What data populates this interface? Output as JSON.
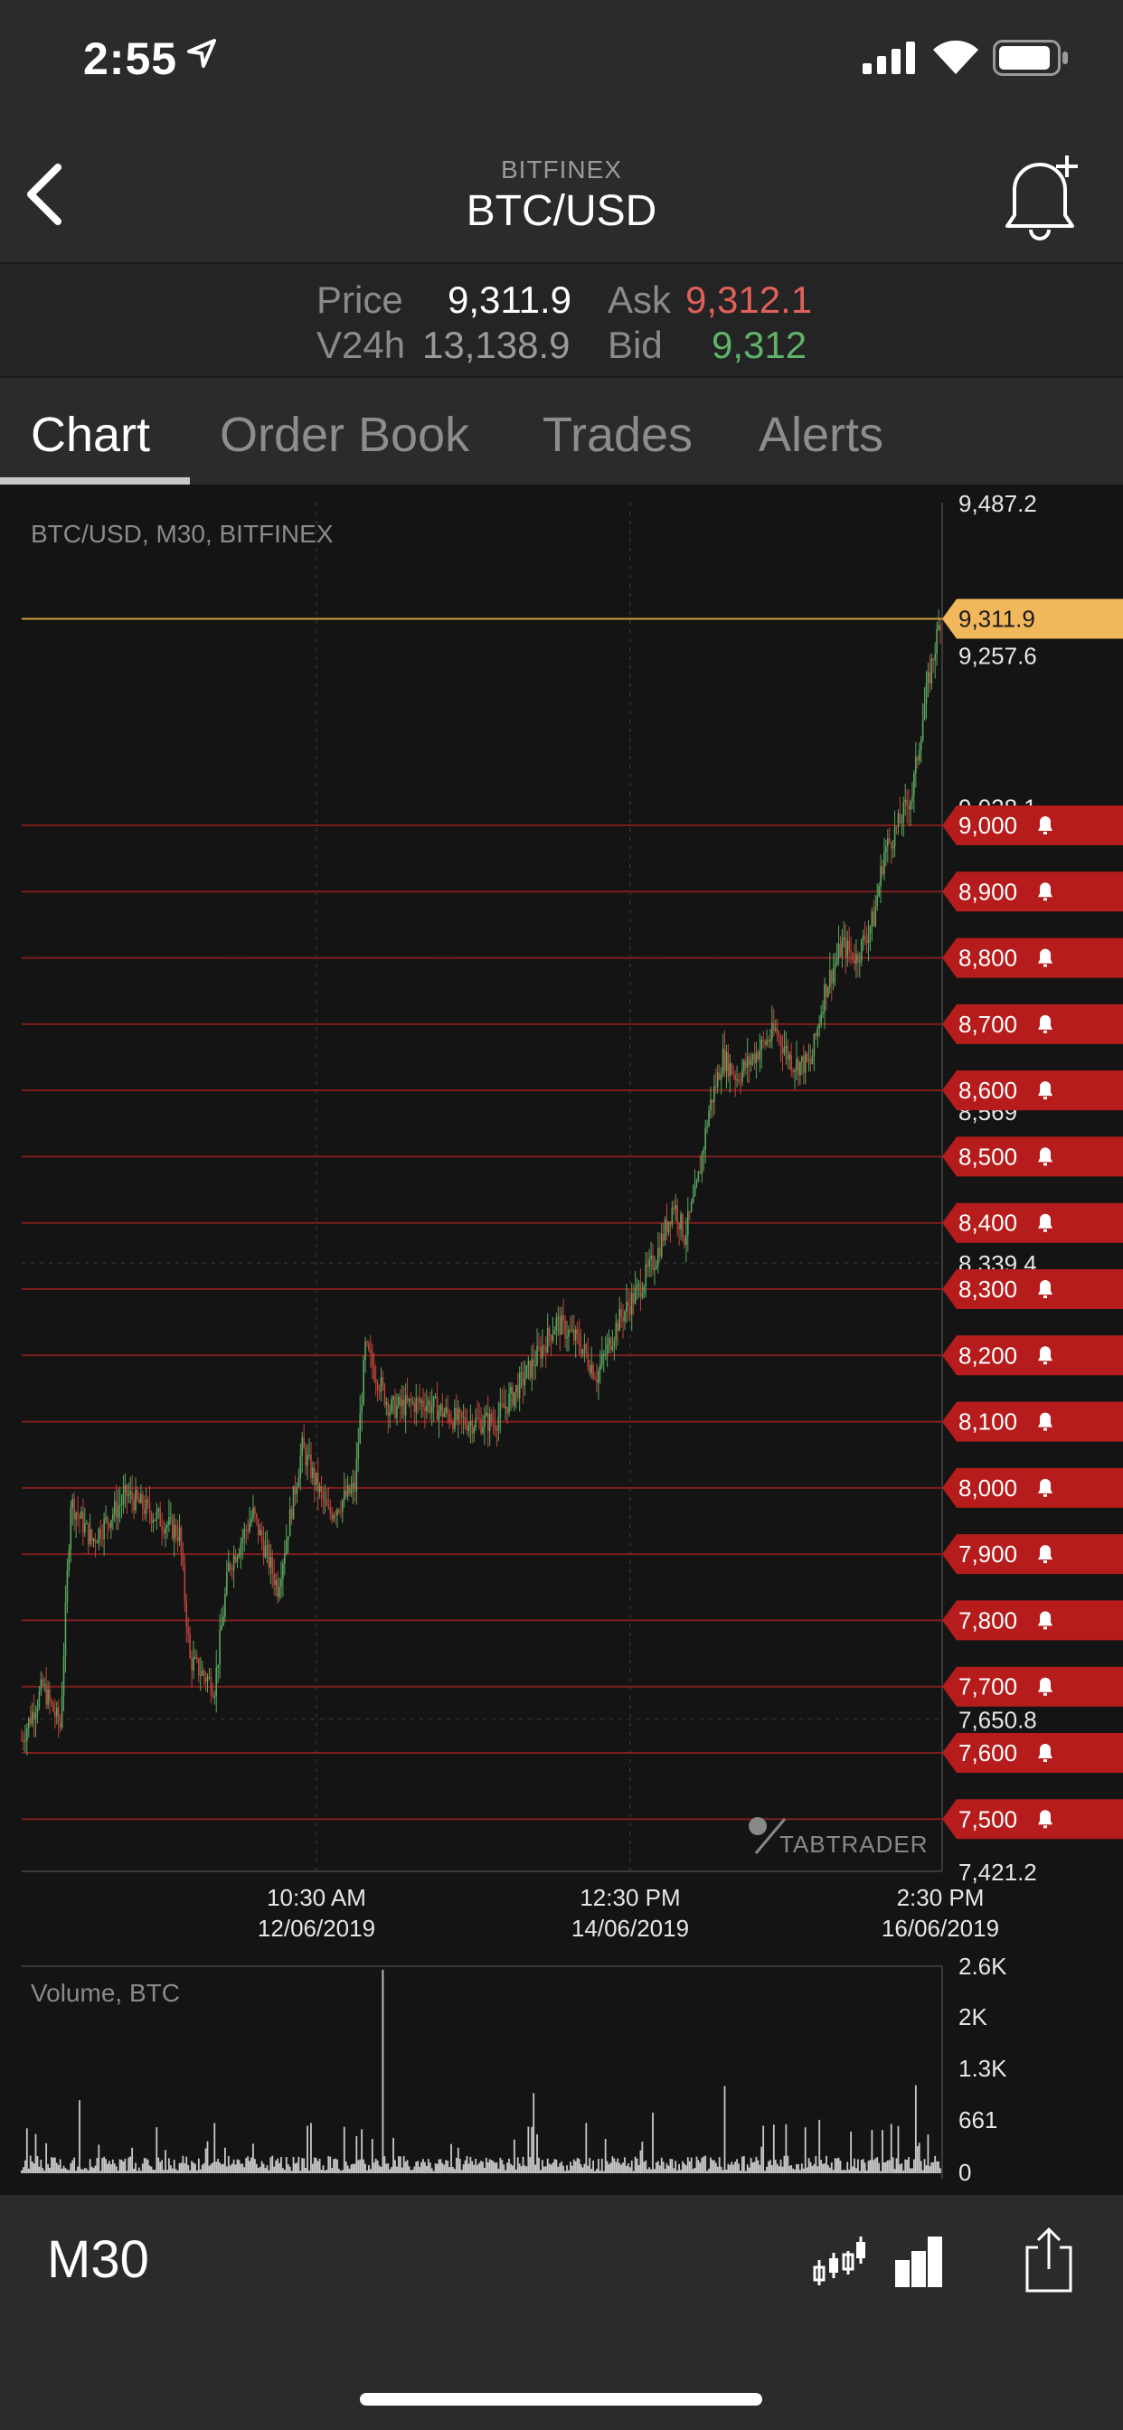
{
  "status_bar": {
    "time": "2:55",
    "icons": [
      "location-arrow-icon",
      "cellular-signal-icon",
      "wifi-icon",
      "battery-icon"
    ]
  },
  "header": {
    "exchange": "BITFINEX",
    "pair": "BTC/USD",
    "back_icon": "chevron-left-icon",
    "alert_icon": "bell-plus-icon"
  },
  "price_info": {
    "price_label": "Price",
    "price_value": "9,311.9",
    "ask_label": "Ask",
    "ask_value": "9,312.1",
    "v24h_label": "V24h",
    "v24h_value": "13,138.9",
    "bid_label": "Bid",
    "bid_value": "9,312",
    "colors": {
      "ask": "#e0605a",
      "bid": "#5fb36a"
    }
  },
  "tabs": [
    {
      "label": "Chart",
      "active": true
    },
    {
      "label": "Order Book",
      "active": false
    },
    {
      "label": "Trades",
      "active": false
    },
    {
      "label": "Alerts",
      "active": false
    }
  ],
  "chart": {
    "legend": "BTC/USD, M30, BITFINEX",
    "watermark": "TABTRADER",
    "volume_label": "Volume, BTC",
    "colors": {
      "background": "#141414",
      "up": "#5aa860",
      "down": "#c0463c",
      "alert_tag": "#b71c1c",
      "current_price_tag": "#f0b85a",
      "volume_bar": "#c8c8c8"
    }
  },
  "chart_data": [
    {
      "type": "candlestick",
      "title": "BTC/USD, M30, BITFINEX",
      "ylim": [
        7421.2,
        9487.2
      ],
      "y_ticks": [
        "9,487.2",
        "9,257.6",
        "9,028.1",
        "8,569",
        "8,339.4",
        "7,650.8",
        "7,421.2"
      ],
      "current_price": 9311.9,
      "current_price_label": "9,311.9",
      "alert_levels": [
        9000,
        8900,
        8800,
        8700,
        8600,
        8500,
        8400,
        8300,
        8200,
        8100,
        8000,
        7900,
        7800,
        7700,
        7600,
        7500
      ],
      "alert_labels": [
        "9,000",
        "8,900",
        "8,800",
        "8,700",
        "8,600",
        "8,500",
        "8,400",
        "8,300",
        "8,200",
        "8,100",
        "8,000",
        "7,900",
        "7,800",
        "7,700",
        "7,600",
        "7,500"
      ],
      "x_ticks": [
        {
          "time": "10:30 AM",
          "date": "12/06/2019"
        },
        {
          "time": "12:30 PM",
          "date": "14/06/2019"
        },
        {
          "time": "2:30 PM",
          "date": "16/06/2019"
        }
      ],
      "close_path": [
        [
          0,
          7620
        ],
        [
          12,
          7700
        ],
        [
          22,
          7640
        ],
        [
          28,
          7980
        ],
        [
          40,
          7920
        ],
        [
          60,
          7990
        ],
        [
          75,
          7960
        ],
        [
          90,
          7930
        ],
        [
          96,
          7740
        ],
        [
          110,
          7700
        ],
        [
          118,
          7880
        ],
        [
          132,
          7960
        ],
        [
          146,
          7850
        ],
        [
          160,
          8060
        ],
        [
          175,
          7960
        ],
        [
          190,
          8000
        ],
        [
          196,
          8210
        ],
        [
          210,
          8120
        ],
        [
          230,
          8130
        ],
        [
          250,
          8100
        ],
        [
          270,
          8100
        ],
        [
          290,
          8180
        ],
        [
          305,
          8250
        ],
        [
          318,
          8220
        ],
        [
          328,
          8170
        ],
        [
          340,
          8250
        ],
        [
          352,
          8300
        ],
        [
          362,
          8350
        ],
        [
          372,
          8430
        ],
        [
          378,
          8380
        ],
        [
          385,
          8450
        ],
        [
          392,
          8570
        ],
        [
          400,
          8650
        ],
        [
          408,
          8620
        ],
        [
          420,
          8660
        ],
        [
          430,
          8690
        ],
        [
          440,
          8640
        ],
        [
          450,
          8640
        ],
        [
          458,
          8750
        ],
        [
          468,
          8820
        ],
        [
          476,
          8800
        ],
        [
          486,
          8860
        ],
        [
          492,
          8960
        ],
        [
          500,
          9000
        ],
        [
          508,
          9050
        ],
        [
          516,
          9200
        ],
        [
          524,
          9311.9
        ]
      ]
    },
    {
      "type": "bar",
      "title": "Volume, BTC",
      "ylim": [
        0,
        2600
      ],
      "y_ticks": [
        "2.6K",
        "2K",
        "1.3K",
        "661",
        "0"
      ],
      "spikes": [
        [
          33,
          930
        ],
        [
          110,
          640
        ],
        [
          165,
          640
        ],
        [
          206,
          2590
        ],
        [
          292,
          1020
        ],
        [
          322,
          640
        ],
        [
          360,
          770
        ],
        [
          401,
          1110
        ],
        [
          455,
          680
        ],
        [
          473,
          530
        ],
        [
          500,
          600
        ],
        [
          510,
          1120
        ]
      ],
      "baseline": 140
    }
  ]
}
